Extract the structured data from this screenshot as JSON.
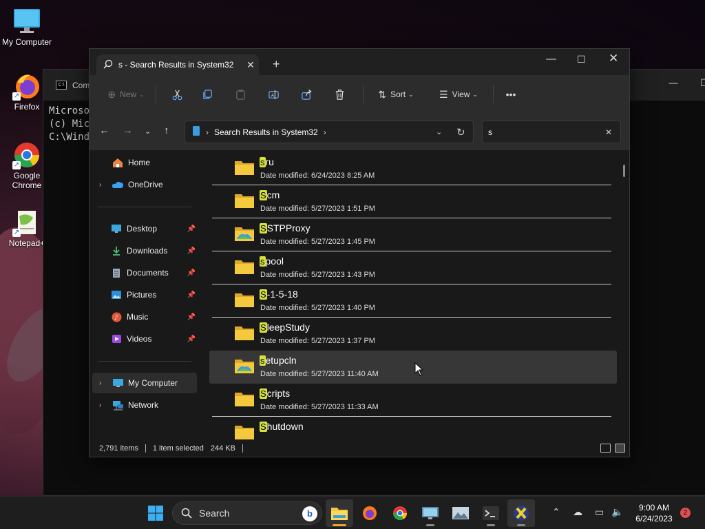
{
  "desktop": {
    "icons": [
      {
        "label": "My Computer"
      },
      {
        "label": "Firefox"
      },
      {
        "label": "Google Chrome"
      },
      {
        "label": "Notepad+"
      }
    ]
  },
  "cmd": {
    "title": "Com",
    "lines": [
      "Microso",
      "(c) Mic",
      "",
      "C:\\Wind"
    ]
  },
  "explorer": {
    "tab_title": "s - Search Results in System32",
    "toolbar": {
      "new_label": "New",
      "sort_label": "Sort",
      "view_label": "View",
      "more_label": "•••"
    },
    "address": {
      "path": "Search Results in System32"
    },
    "search": {
      "value": "s"
    },
    "sidebar": {
      "home": "Home",
      "onedrive": "OneDrive",
      "desktop": "Desktop",
      "downloads": "Downloads",
      "documents": "Documents",
      "pictures": "Pictures",
      "music": "Music",
      "videos": "Videos",
      "mycomputer": "My Computer",
      "network": "Network"
    },
    "items": [
      {
        "hl": "s",
        "rest": "ru",
        "date": "Date modified:  6/24/2023 8:25 AM"
      },
      {
        "hl": "S",
        "rest": "cm",
        "date": "Date modified:  5/27/2023 1:51 PM"
      },
      {
        "hl": "S",
        "rest": "STPProxy",
        "date": "Date modified:  5/27/2023 1:45 PM"
      },
      {
        "hl": "s",
        "rest": "pool",
        "date": "Date modified:  5/27/2023 1:43 PM"
      },
      {
        "hl": "S",
        "rest": "-1-5-18",
        "date": "Date modified:  5/27/2023 1:40 PM"
      },
      {
        "hl": "S",
        "rest": "leepStudy",
        "date": "Date modified:  5/27/2023 1:37 PM"
      },
      {
        "hl": "s",
        "rest": "etupcln",
        "date": "Date modified:  5/27/2023 11:40 AM"
      },
      {
        "hl": "S",
        "rest": "cripts",
        "date": "Date modified:  5/27/2023 11:33 AM"
      },
      {
        "hl": "S",
        "rest": "hutdown",
        "date": ""
      }
    ],
    "status": {
      "count": "2,791 items",
      "selected": "1 item selected",
      "size": "244 KB"
    }
  },
  "taskbar": {
    "search_placeholder": "Search",
    "time": "9:00 AM",
    "date": "6/24/2023",
    "notifications": "2"
  },
  "colors": {
    "highlight": "#d6e23a",
    "folder": "#f4c93e",
    "accent": "#e9a13b"
  }
}
